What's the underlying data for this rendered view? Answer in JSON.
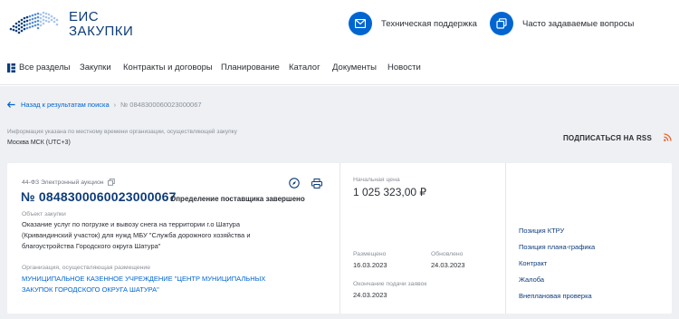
{
  "header": {
    "logo": {
      "line1": "ЕИС",
      "line2": "ЗАКУПКИ"
    },
    "support_label": "Техническая поддержка",
    "faq_label": "Часто задаваемые вопросы",
    "accent_color": "#0065d1"
  },
  "nav": {
    "items": [
      "Все разделы",
      "Закупки",
      "Контракты и договоры",
      "Планирование",
      "Каталог",
      "Документы",
      "Новости"
    ]
  },
  "breadcrumbs": {
    "back": "Назад к результатам поиска",
    "current": "№ 0848300060023000067"
  },
  "timezone": {
    "note": "Информация указана по местному времени организации, осуществляющей закупку",
    "value": "Москва МСК (UTC+3)"
  },
  "rss_label": "ПОДПИСАТЬСЯ НА RSS",
  "card": {
    "law_type": "44-ФЗ Электронный аукцион",
    "number": "№ 0848300060023000067",
    "status": "Определение поставщика завершено",
    "object_label": "Объект закупки",
    "object_lines": [
      "Оказание услуг по погрузке и вывозу снега на территории г.о Шатура",
      "(Кривандинский участок) для нужд МБУ \"Служба дорожного хозяйства и",
      "благоустройства Городского округа Шатура\""
    ],
    "org_label": "Организация, осуществляющая размещение",
    "org_lines": [
      "МУНИЦИПАЛЬНОЕ КАЗЕННОЕ УЧРЕЖДЕНИЕ \"ЦЕНТР МУНИЦИПАЛЬНЫХ",
      "ЗАКУПОК ГОРОДСКОГО ОКРУГА ШАТУРА\""
    ],
    "price_label": "Начальная цена",
    "price": "1 025 323,00 ₽",
    "posted_label": "Размещено",
    "posted": "16.03.2023",
    "updated_label": "Обновлено",
    "updated": "24.03.2023",
    "deadline_label": "Окончание подачи заявок",
    "deadline": "24.03.2023",
    "links": [
      "Позиция КТРУ",
      "Позиция плана-графика",
      "Контракт",
      "Жалоба",
      "Внеплановая проверка"
    ]
  }
}
